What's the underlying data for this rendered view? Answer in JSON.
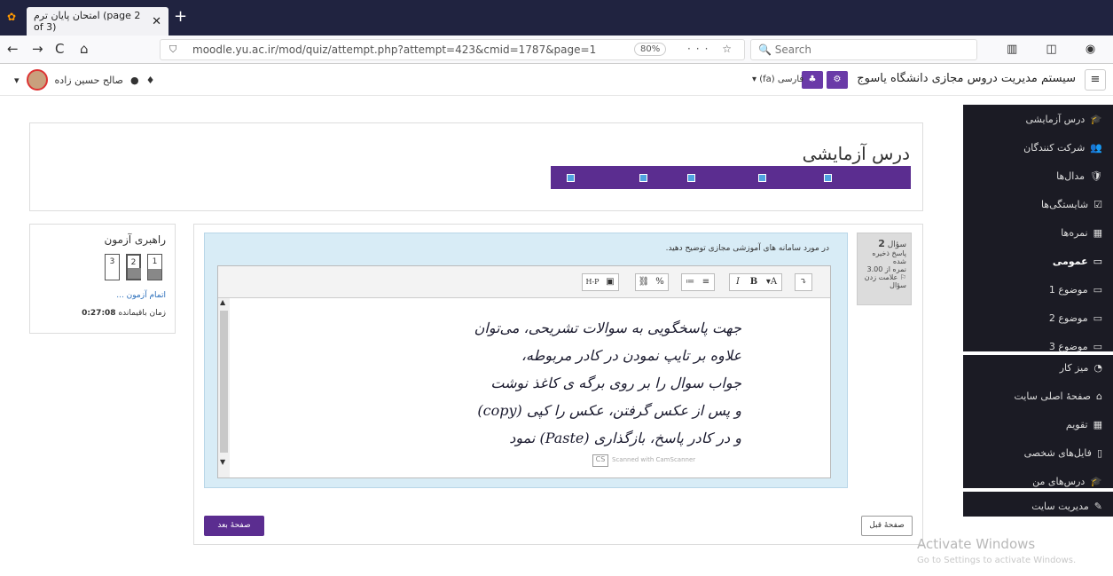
{
  "browser": {
    "tab_title": "امتحان پایان ترم (page 2 of 3)",
    "tab_close": "✕",
    "new_tab": "+",
    "url": "moodle.yu.ac.ir/mod/quiz/attempt.php?attempt=423&cmid=1787&page=1",
    "zoom": "80%",
    "url_tools": "··· ☆",
    "search_placeholder": "Search",
    "nav_right": "▥ ◫ ◉",
    "back": "←",
    "forward": "→",
    "reload": "C",
    "home": "⌂"
  },
  "header": {
    "menu": "≡",
    "site_name": "سیستم مدیریت دروس مجازی دانشگاه یاسوج",
    "cog": "⚙",
    "network": "♣",
    "language": "فارسی (fa) ▾",
    "user_name": "صالح حسین زاده",
    "user_dropdown": "▾",
    "bell": "♦",
    "chat": "●"
  },
  "sidebar": {
    "items": [
      {
        "label": "درس آزمایشی",
        "icon": "🎓",
        "bold": false
      },
      {
        "label": "شرکت کنندگان",
        "icon": "👥",
        "bold": false
      },
      {
        "label": "مدال‌ها",
        "icon": "🛡",
        "bold": false
      },
      {
        "label": "شایستگی‌ها",
        "icon": "☑",
        "bold": false
      },
      {
        "label": "نمره‌ها",
        "icon": "▦",
        "bold": false
      },
      {
        "label": "عمومی",
        "icon": "▭",
        "bold": true
      },
      {
        "label": "موضوع 1",
        "icon": "▭",
        "bold": false
      },
      {
        "label": "موضوع 2",
        "icon": "▭",
        "bold": false
      },
      {
        "label": "موضوع 3",
        "icon": "▭",
        "bold": false
      },
      {
        "label": "میز کار",
        "icon": "◔",
        "bold": false
      },
      {
        "label": "صفحهٔ اصلی سایت",
        "icon": "⌂",
        "bold": false
      },
      {
        "label": "تقویم",
        "icon": "▦",
        "bold": false
      },
      {
        "label": "فایل‌های شخصی",
        "icon": "▯",
        "bold": false
      },
      {
        "label": "درس‌های من",
        "icon": "🎓",
        "bold": false
      },
      {
        "label": "مدیریت سایت",
        "icon": "✎",
        "bold": false
      }
    ]
  },
  "course": {
    "title": "درس آزمایشی"
  },
  "quiz_nav": {
    "title": "راهبری آزمون",
    "buttons": [
      "3",
      "2",
      "1"
    ],
    "finish": "اتمام آزمون ...",
    "time_label": "زمان باقیمانده",
    "time_value": "0:27:08"
  },
  "question": {
    "number_label": "سؤال",
    "number": "2",
    "status": "پاسخ ذخیره شده",
    "mark": "نمره از 3.00",
    "flag": "علامت زدن سؤال",
    "text": "در مورد سامانه های آموزشی مجازی توضیح دهید.",
    "answer_lines": [
      "جهت پاسخگویی به سوالات تشریحی، می‌توان",
      "علاوه بر تایپ نمودن در کادر مربوطه،",
      "جواب سوال را بر روی برگه ی کاغذ نوشت",
      "و پس از عکس گرفتن، عکس را کپی (copy)",
      "و در کادر پاسخ، بازگذاری (Paste) نمود"
    ],
    "watermark_logo": "CS",
    "watermark_text": "Scanned with CamScanner"
  },
  "toolbar": {
    "buttons": [
      "H-P",
      "▣",
      "⛓",
      "%",
      "≔",
      "≡",
      "I",
      "B",
      "▾A",
      "⤵"
    ]
  },
  "nav_buttons": {
    "next": "صفحهٔ بعد",
    "prev": "صفحهٔ قبل"
  },
  "os": {
    "activate_title": "Activate Windows",
    "activate_sub": "Go to Settings to activate Windows."
  }
}
